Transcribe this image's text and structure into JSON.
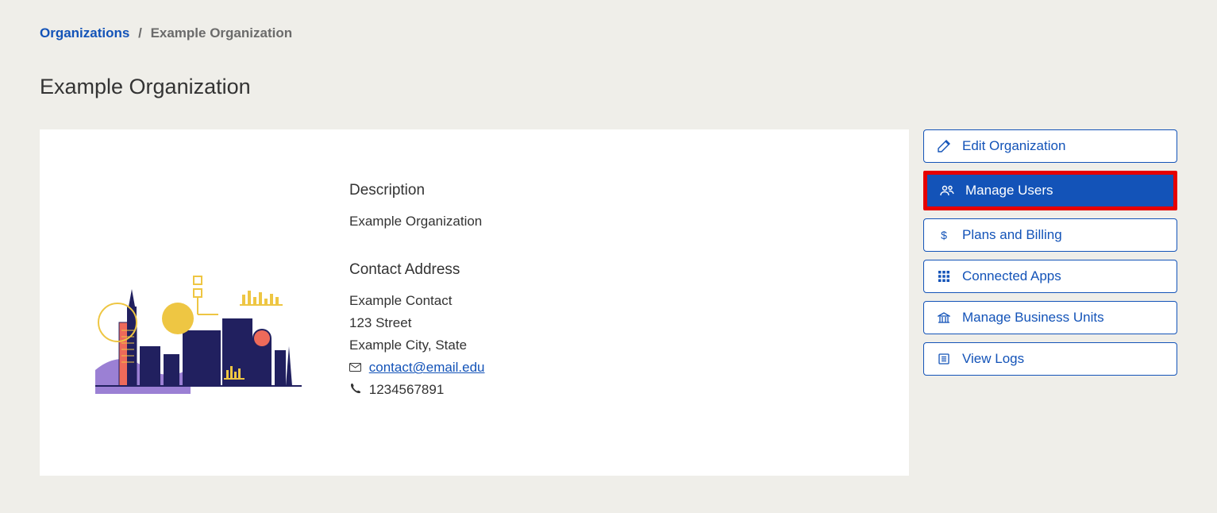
{
  "breadcrumb": {
    "root": "Organizations",
    "current": "Example Organization"
  },
  "title": "Example Organization",
  "description": {
    "heading": "Description",
    "text": "Example Organization"
  },
  "contact": {
    "heading": "Contact Address",
    "name": "Example Contact",
    "street": "123 Street",
    "city_state": "Example City, State",
    "email": "contact@email.edu",
    "phone": "1234567891"
  },
  "actions": {
    "edit": "Edit Organization",
    "manage_users": "Manage Users",
    "plans_billing": "Plans and Billing",
    "connected_apps": "Connected Apps",
    "manage_bu": "Manage Business Units",
    "view_logs": "View Logs"
  }
}
